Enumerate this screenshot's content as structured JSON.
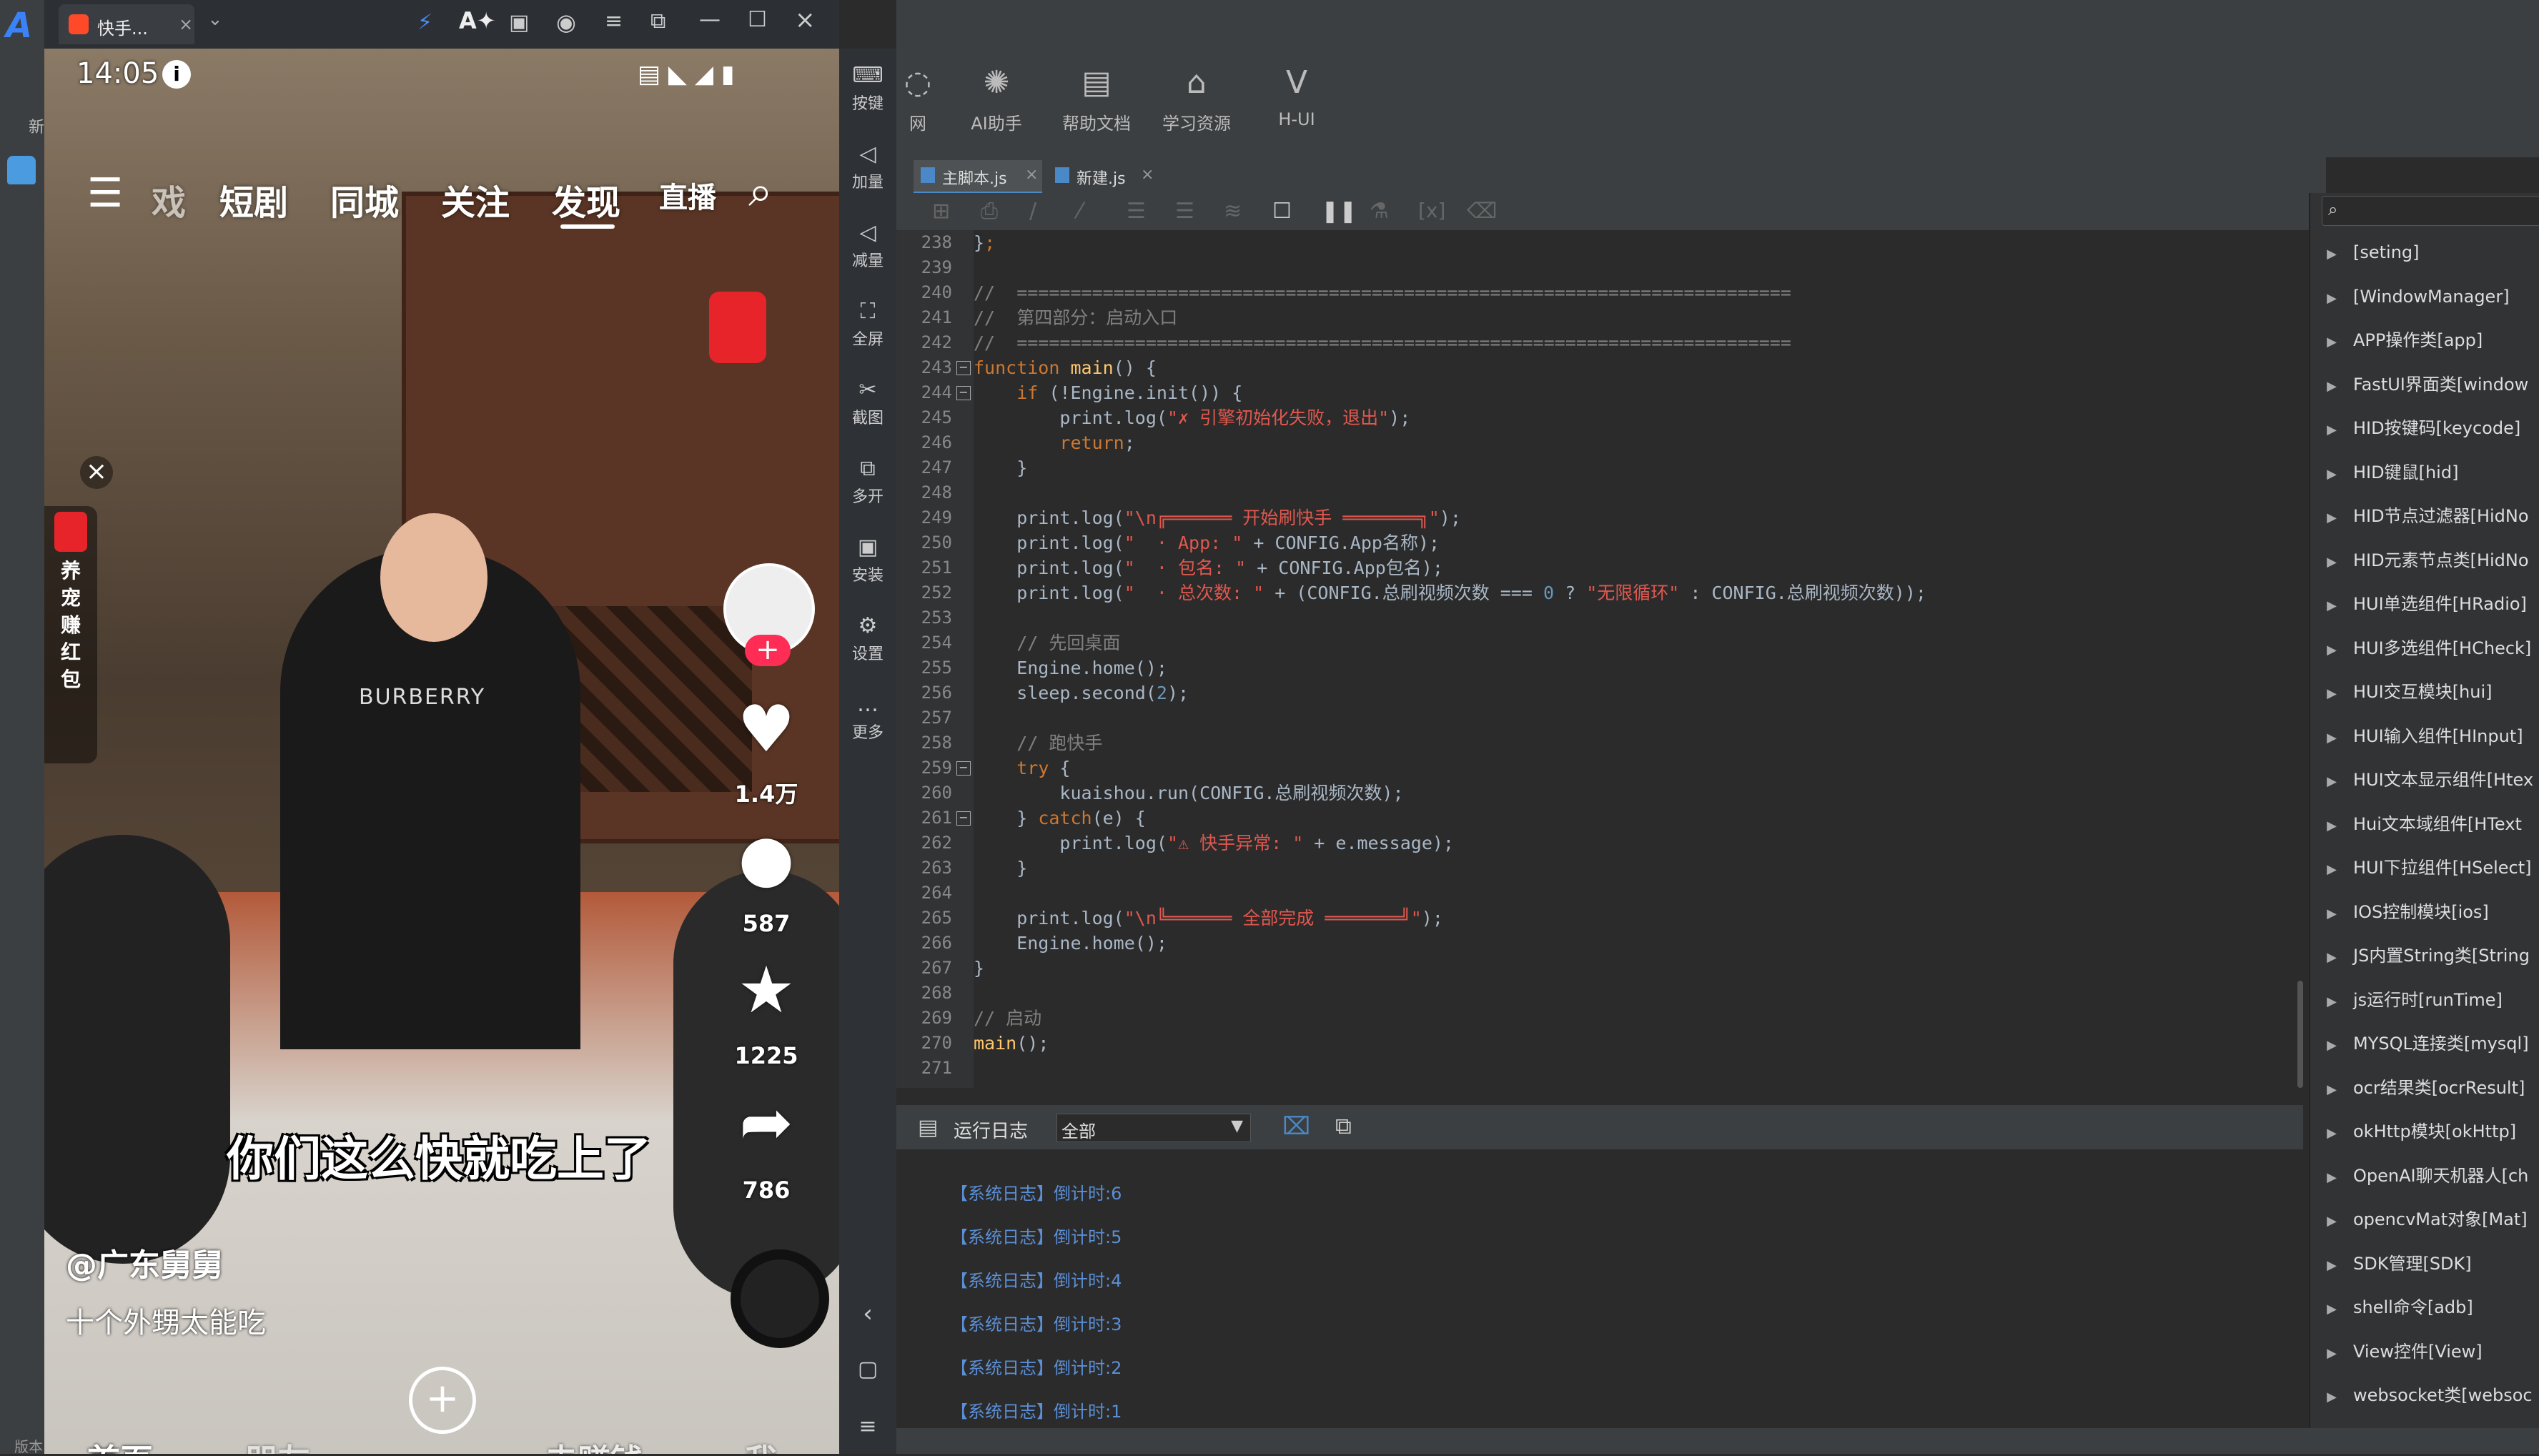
{
  "emulator": {
    "tab_title": "快手...",
    "time": "14:05"
  },
  "app": {
    "nav_tabs": [
      "戏",
      "短剧",
      "同城",
      "关注",
      "发现",
      "直播"
    ],
    "likes": "1.4万",
    "comments": "587",
    "favorites": "1225",
    "shares": "786",
    "caption": "你们这么快就吃上了",
    "author": "@广东舅舅",
    "description": "十个外甥太能吃",
    "promo": "养\n宠\n赚\n红\n包",
    "bottom_nav": [
      "首页",
      "朋友",
      "去赚钱",
      "我"
    ],
    "shirt_text": "BURBERRY"
  },
  "emulator_side": [
    "按键",
    "加量",
    "减量",
    "全屏",
    "截图",
    "多开",
    "安装",
    "设置",
    "更多"
  ],
  "ide": {
    "toolbar": [
      {
        "label": "网",
        "icon": "globe-icon"
      },
      {
        "label": "AI助手",
        "icon": "openai-icon"
      },
      {
        "label": "帮助文档",
        "icon": "document-icon"
      },
      {
        "label": "学习资源",
        "icon": "graduation-icon"
      },
      {
        "label": "H-UI",
        "icon": "vue-icon"
      }
    ],
    "file_tabs": [
      "主脚本.js",
      "新建.js"
    ],
    "line_numbers": [
      238,
      239,
      240,
      241,
      242,
      243,
      244,
      245,
      246,
      247,
      248,
      249,
      250,
      251,
      252,
      253,
      254,
      255,
      256,
      257,
      258,
      259,
      260,
      261,
      262,
      263,
      264,
      265,
      266,
      267,
      268,
      269,
      270,
      271
    ],
    "log_title": "运行日志",
    "log_filter": "全部",
    "logs": [
      "【系统日志】倒计时:6",
      "【系统日志】倒计时:5",
      "【系统日志】倒计时:4",
      "【系统日志】倒计时:3",
      "【系统日志】倒计时:2",
      "【系统日志】倒计时:1"
    ],
    "tree": [
      "[seting]",
      "[WindowManager]",
      "APP操作类[app]",
      "FastUI界面类[window",
      "HID按键码[keycode]",
      "HID键鼠[hid]",
      "HID节点过滤器[HidNo",
      "HID元素节点类[HidNo",
      "HUI单选组件[HRadio]",
      "HUI多选组件[HCheck]",
      "HUI交互模块[hui]",
      "HUI输入组件[HInput]",
      "HUI文本显示组件[Htex",
      "Hui文本域组件[HText",
      "HUI下拉组件[HSelect]",
      "IOS控制模块[ios]",
      "JS内置String类[String",
      "js运行时[runTime]",
      "MYSQL连接类[mysql]",
      "ocr结果类[ocrResult]",
      "okHttp模块[okHttp]",
      "OpenAI聊天机器人[ch",
      "opencvMat对象[Mat]",
      "SDK管理[SDK]",
      "shell命令[adb]",
      "View控件[View]",
      "websocket类[websoc"
    ]
  },
  "colors": {
    "keyword": "#cc7832",
    "string": "#e0584f",
    "comment": "#808080",
    "number": "#6897bb",
    "log": "#5b8fd6"
  }
}
